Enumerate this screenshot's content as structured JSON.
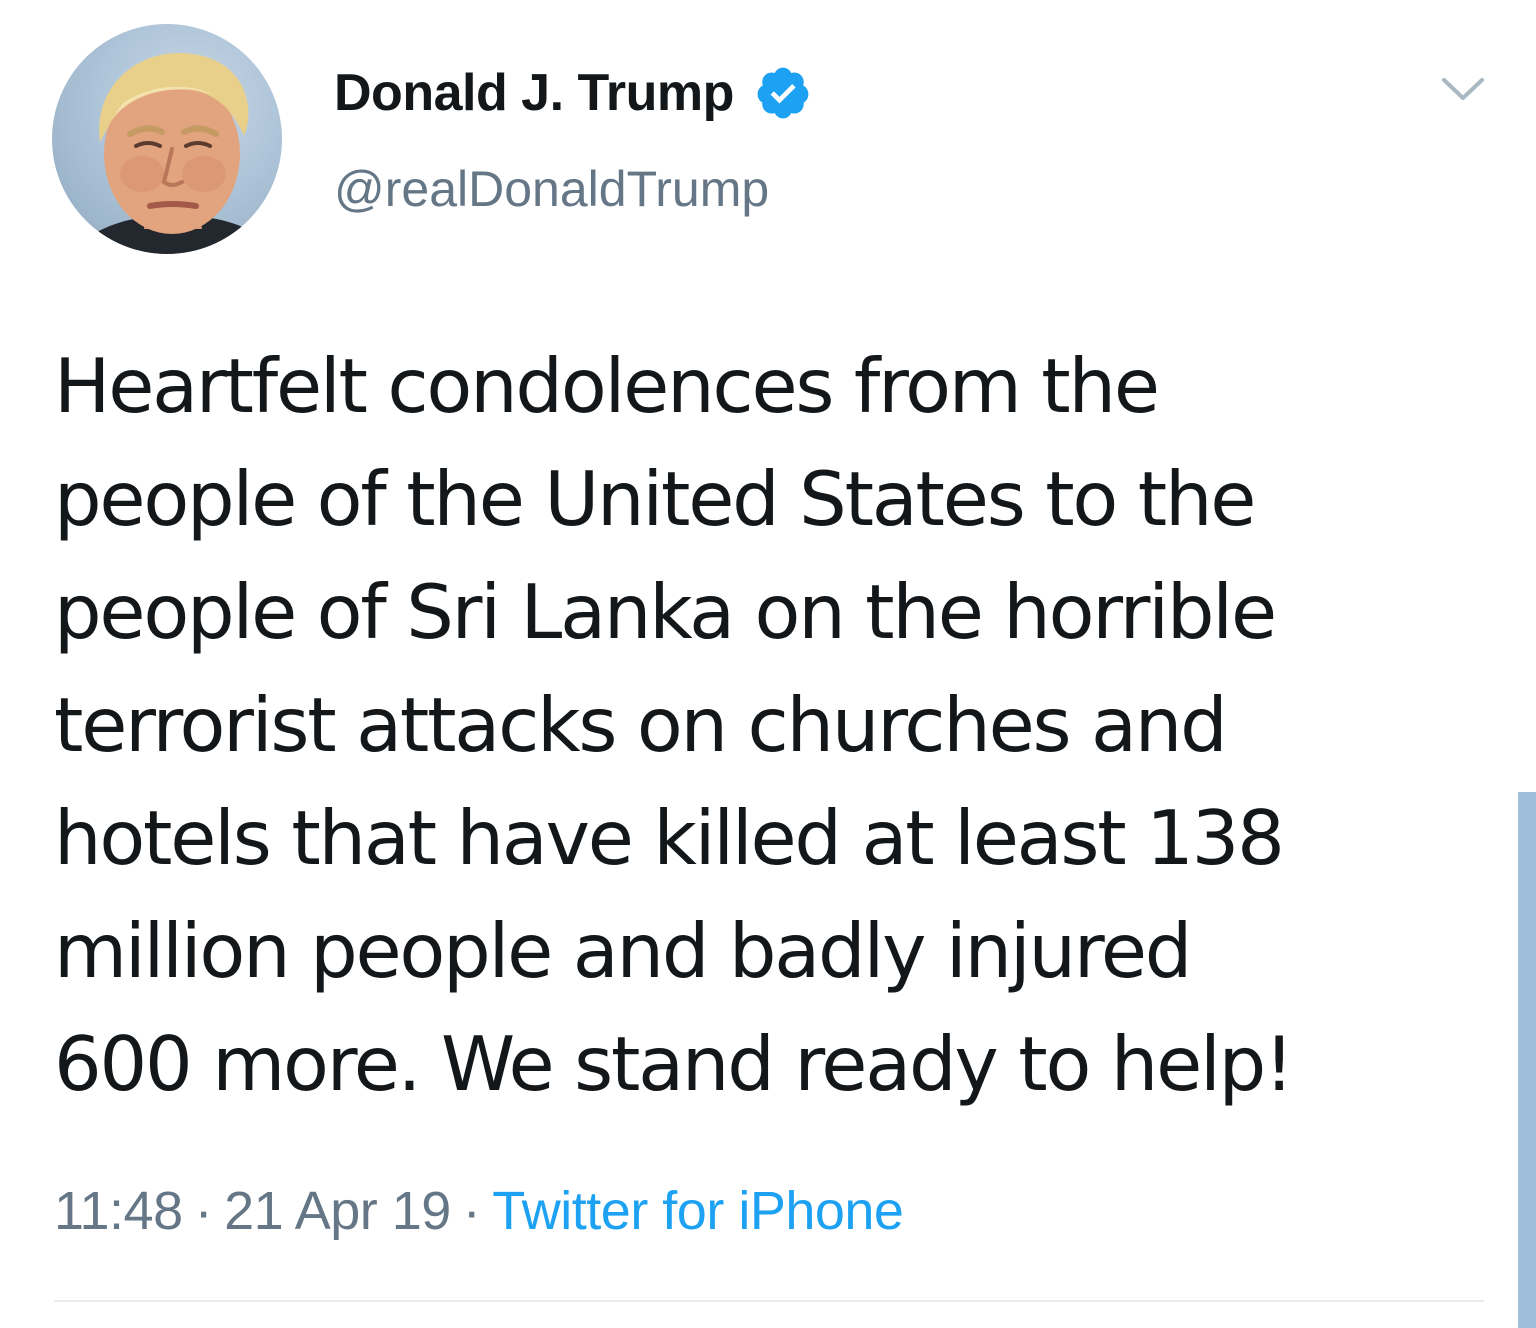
{
  "tweet": {
    "author": {
      "display_name": "Donald J. Trump",
      "handle": "@realDonaldTrump",
      "verified": true,
      "avatar_icon": "profile-photo"
    },
    "text_lines": [
      "Heartfelt condolences from the",
      "people of the United States to the",
      "people of Sri Lanka on the horrible",
      "terrorist attacks on churches and",
      "hotels that have killed at least 138",
      "million people and badly injured",
      "600 more. We stand ready to help!"
    ],
    "time": "11:48",
    "date": "21 Apr 19",
    "separator": "·",
    "source": "Twitter for iPhone"
  },
  "colors": {
    "text": "#14171a",
    "secondary": "#657786",
    "link": "#1da1f2",
    "verified_badge": "#1da1f2",
    "divider": "#e6ecf0"
  },
  "icons": {
    "verified": "verified-badge-icon",
    "menu": "chevron-down-icon"
  }
}
